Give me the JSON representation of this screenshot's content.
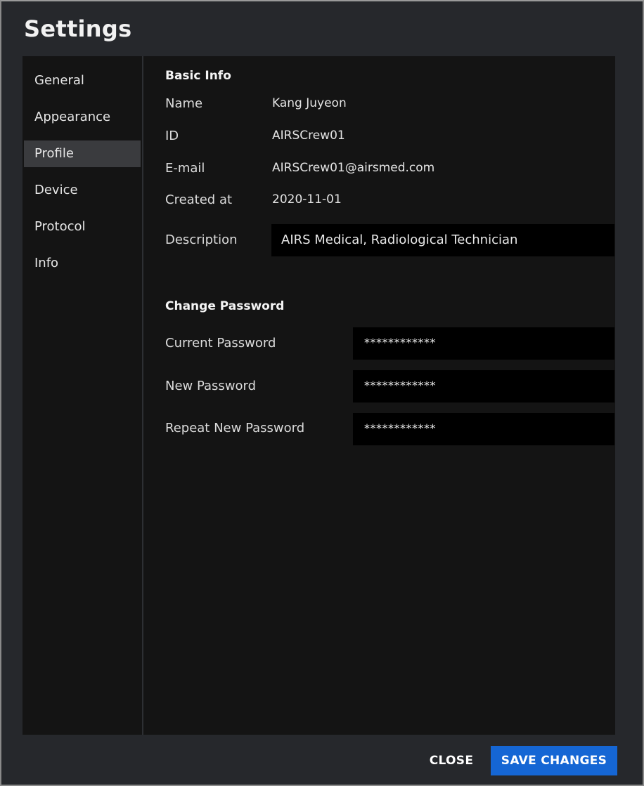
{
  "window": {
    "title": "Settings"
  },
  "sidebar": {
    "items": [
      {
        "label": "General",
        "active": false
      },
      {
        "label": "Appearance",
        "active": false
      },
      {
        "label": "Profile",
        "active": true
      },
      {
        "label": "Device",
        "active": false
      },
      {
        "label": "Protocol",
        "active": false
      },
      {
        "label": "Info",
        "active": false
      }
    ]
  },
  "basic_info": {
    "title": "Basic Info",
    "fields": [
      {
        "label": "Name",
        "value": "Kang Juyeon"
      },
      {
        "label": "ID",
        "value": "AIRSCrew01"
      },
      {
        "label": "E-mail",
        "value": "AIRSCrew01@airsmed.com"
      },
      {
        "label": "Created at",
        "value": "2020-11-01"
      }
    ],
    "description": {
      "label": "Description",
      "value": "AIRS Medical, Radiological Technician"
    }
  },
  "change_password": {
    "title": "Change Password",
    "fields": [
      {
        "label": "Current Password",
        "value": "************"
      },
      {
        "label": "New Password",
        "value": "************"
      },
      {
        "label": "Repeat New Password",
        "value": "************"
      }
    ]
  },
  "footer": {
    "close_label": "CLOSE",
    "save_label": "SAVE CHANGES"
  },
  "colors": {
    "accent": "#1566d4",
    "window_bg": "#26282c",
    "panel_bg": "#141414",
    "active_item_bg": "#3a3b3e",
    "input_bg": "#000000"
  }
}
